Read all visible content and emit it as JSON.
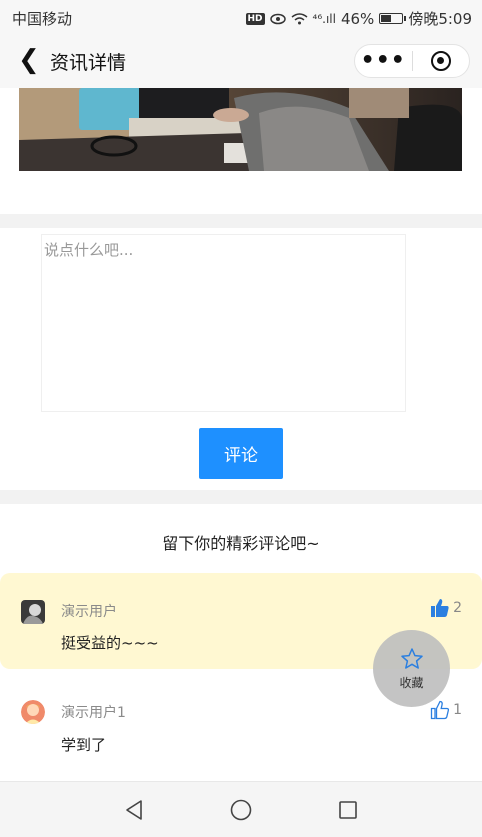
{
  "status_bar": {
    "carrier": "中国移动",
    "hd_badge": "HD",
    "network": "⁴⁶.ıll",
    "battery_percent": "46%",
    "time": "傍晚5:09"
  },
  "nav": {
    "title": "资讯详情",
    "more_label": "•••"
  },
  "comment_form": {
    "placeholder": "说点什么吧...",
    "submit_label": "评论"
  },
  "comments_section": {
    "title": "留下你的精彩评论吧~",
    "items": [
      {
        "user": "演示用户",
        "text": "挺受益的~~~",
        "likes": "2",
        "liked": true
      },
      {
        "user": "演示用户1",
        "text": "学到了",
        "likes": "1",
        "liked": false
      }
    ]
  },
  "favorite": {
    "label": "收藏"
  },
  "colors": {
    "accent": "#1e90ff",
    "highlight_row": "#fff8d2",
    "separator": "#f2f2f2"
  },
  "icons": {
    "back": "back-icon",
    "close": "target-icon",
    "like": "thumbs-up-icon",
    "favorite": "star-icon",
    "sys_back": "triangle-back-icon",
    "sys_home": "circle-home-icon",
    "sys_recent": "square-recent-icon"
  }
}
